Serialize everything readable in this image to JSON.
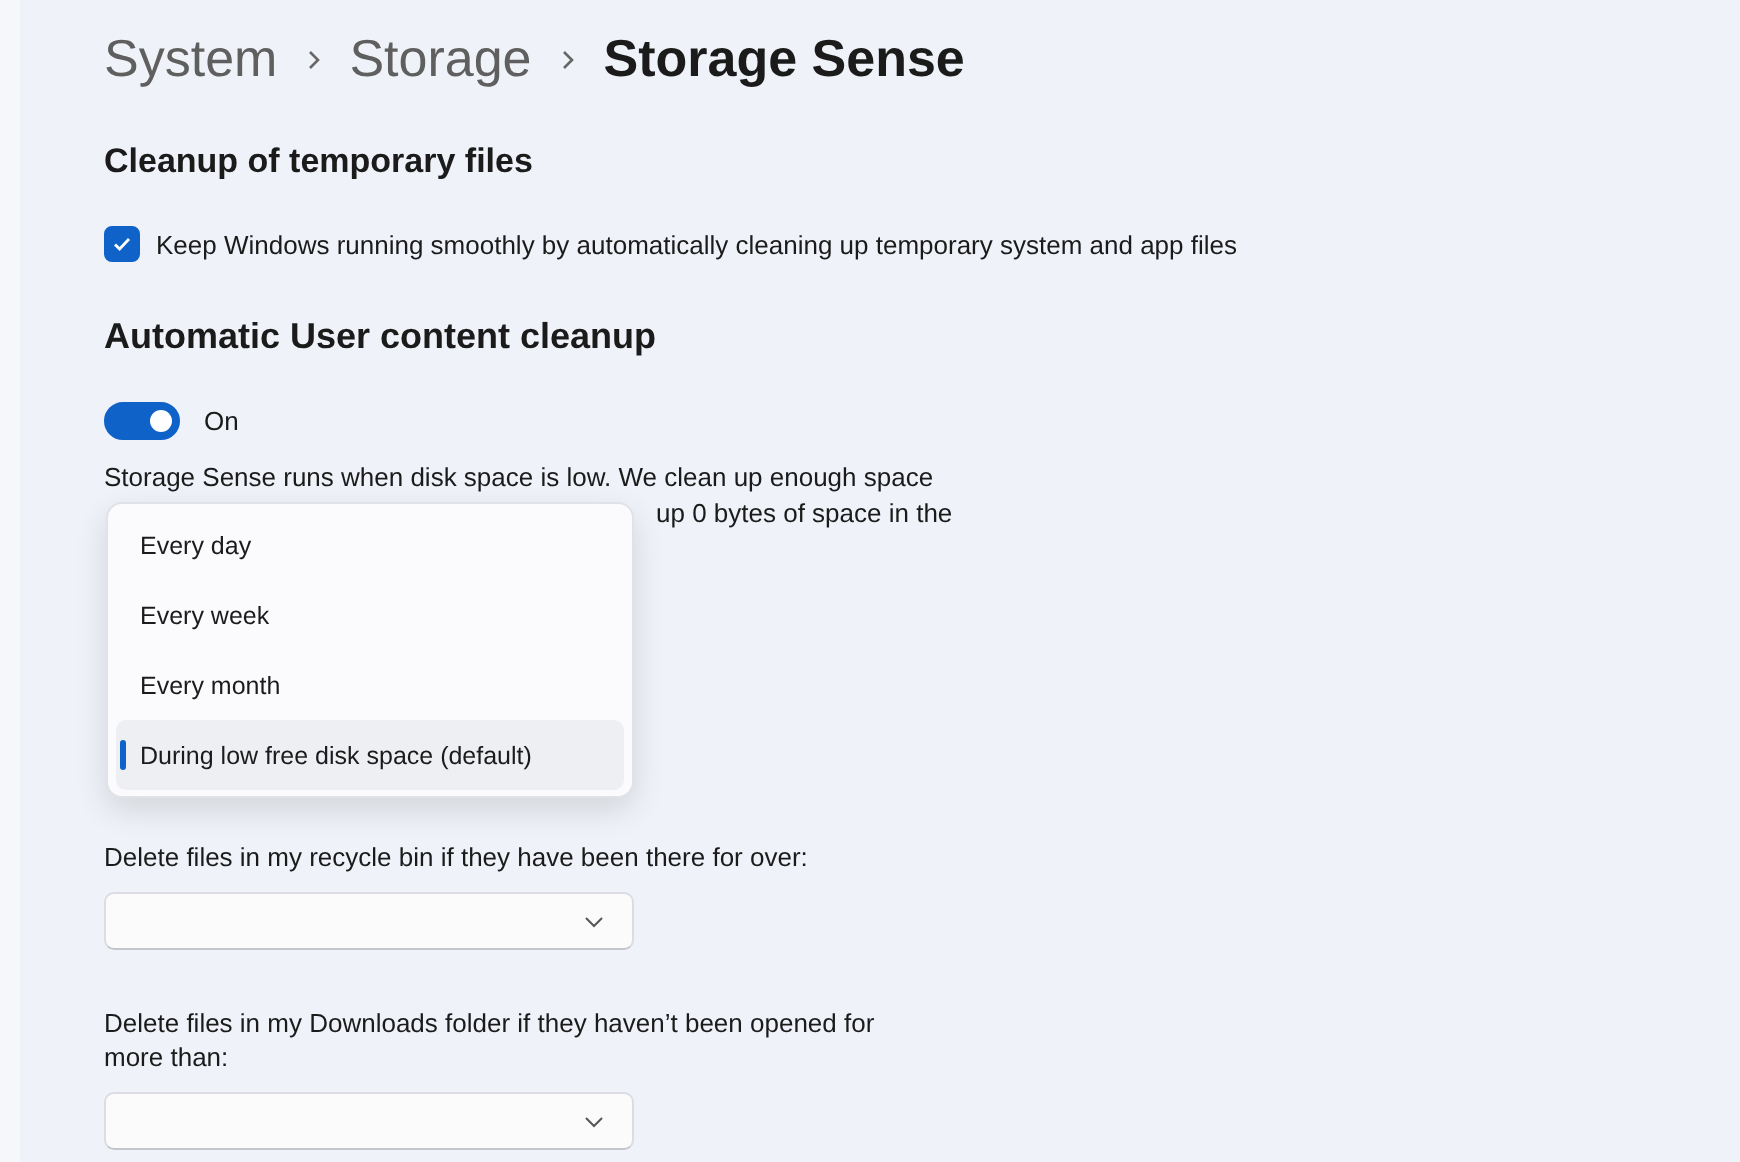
{
  "breadcrumb": [
    {
      "label": "System",
      "current": false
    },
    {
      "label": "Storage",
      "current": false
    },
    {
      "label": "Storage Sense",
      "current": true
    }
  ],
  "temp_files": {
    "heading": "Cleanup of temporary files",
    "checkbox": {
      "label": "Keep Windows running smoothly by automatically cleaning up temporary system and app files",
      "checked": true
    }
  },
  "user_cleanup": {
    "heading": "Automatic User content cleanup",
    "toggle": {
      "label": "On",
      "on": true
    },
    "description": "Storage Sense runs when disk space is low. We clean up enough space",
    "description_visible_part": "up 0 bytes of space in the"
  },
  "run_menu": {
    "options": [
      {
        "label": "Every day",
        "selected": false
      },
      {
        "label": "Every week",
        "selected": false
      },
      {
        "label": "Every month",
        "selected": false
      },
      {
        "label": "During low free disk space (default)",
        "selected": true
      }
    ]
  },
  "recycle_bin": {
    "label": "Delete files in my recycle bin if they have been there for over:"
  },
  "downloads": {
    "label": "Delete files in my Downloads folder if they haven’t been opened for more than:"
  }
}
